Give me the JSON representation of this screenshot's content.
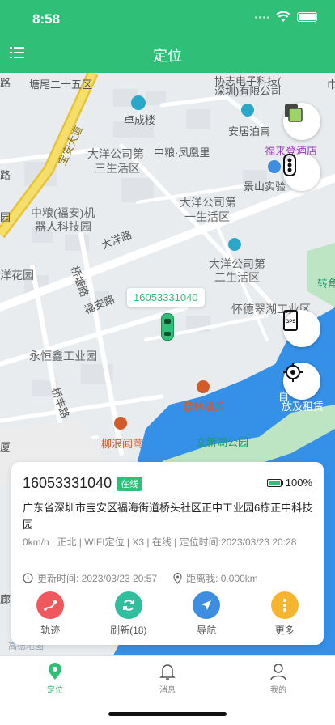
{
  "status": {
    "time": "8:58"
  },
  "header": {
    "title": "定位"
  },
  "map": {
    "labels": {
      "l1": "塘尾二十五区",
      "l2": "协志电子科技(",
      "l3": "深圳)有限公司",
      "l4": "卓成楼",
      "l5": "安居泊寓",
      "l6": "福来登酒店",
      "l7": "大洋公司第",
      "l8": "三生活区",
      "l9": "中粮·凤凰里",
      "l10": "景山实验",
      "l11": "大洋公司第",
      "l12": "一生活区",
      "l13": "中粮(福安)机",
      "l14": "器人科技园",
      "l15": "大洋路",
      "l16": "大洋公司第",
      "l17": "二生活区",
      "l18": "洋花园",
      "l19": "桥塘路",
      "l20": "福安路",
      "l21": "怀德翠湖工业区",
      "l22": "永恒鑫工业园",
      "l23": "桥丰路",
      "l24": "荔林漫步",
      "l25": "柳浪闻莺",
      "l26": "立新湖公园",
      "l27": "厦",
      "l28": "转角",
      "l29": "放及租赁",
      "l30": "宝安大道",
      "l31": "路",
      "l32": "路",
      "l33": "园",
      "l34": "巾",
      "l35": "自",
      "l36": "廊",
      "l37": "高德地图"
    },
    "device_tag": "16053331040"
  },
  "card": {
    "device_id": "16053331040",
    "status_badge": "在线",
    "battery": "100%",
    "address": "广东省深圳市宝安区福海街道桥头社区正中工业园6栋正中科技园",
    "detail": "0km/h | 正北 | WIFI定位 | X3 | 在线 | 定位时间:2023/03/23 20:28",
    "update_time": "更新时间: 2023/03/23 20:57",
    "distance": "距离我: 0.000km",
    "actions": [
      {
        "label": "轨迹",
        "color": "#f0585d",
        "icon": "track-icon"
      },
      {
        "label": "刷新(18)",
        "color": "#2fbf9f",
        "icon": "refresh-icon"
      },
      {
        "label": "导航",
        "color": "#3d8de0",
        "icon": "navigation-icon"
      },
      {
        "label": "更多",
        "color": "#f5b530",
        "icon": "more-icon"
      }
    ]
  },
  "tabs": [
    {
      "label": "定位",
      "icon": "location-pin-icon",
      "active": true
    },
    {
      "label": "消息",
      "icon": "bell-icon",
      "active": false
    },
    {
      "label": "我的",
      "icon": "user-icon",
      "active": false
    }
  ],
  "colors": {
    "accent": "#2fbf77",
    "lake": "#3590e8"
  }
}
